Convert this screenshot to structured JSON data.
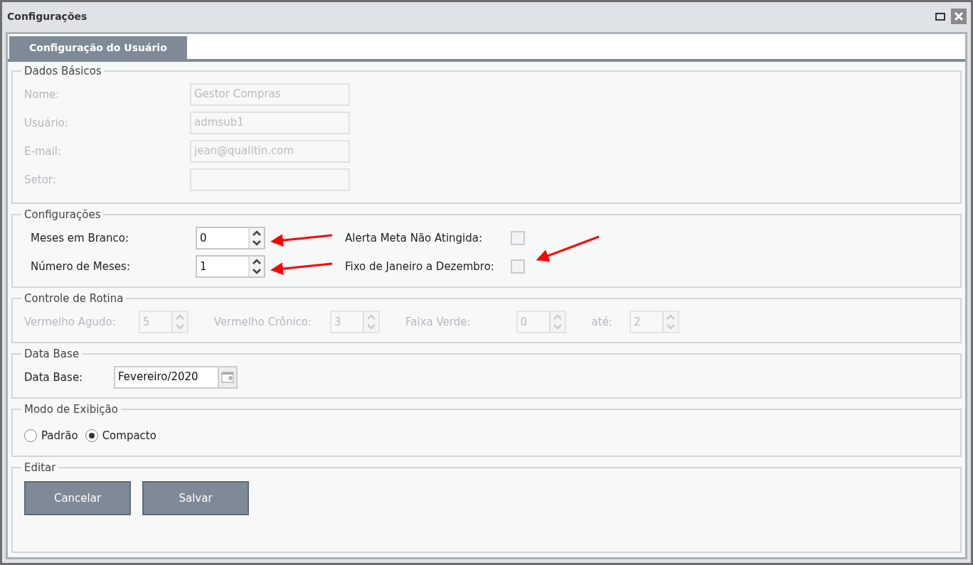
{
  "window": {
    "title": "Configurações"
  },
  "tabs": [
    {
      "label": "Configuração do Usuário",
      "selected": true
    }
  ],
  "dados_basicos": {
    "legend": "Dados Básicos",
    "fields": [
      {
        "label": "Nome:",
        "value": "Gestor Compras",
        "disabled": true
      },
      {
        "label": "Usuário:",
        "value": "admsub1",
        "disabled": true
      },
      {
        "label": "E-mail:",
        "value": "jean@qualitin.com",
        "disabled": true
      },
      {
        "label": "Setor:",
        "disabled": true
      }
    ]
  },
  "configuracoes": {
    "legend": "Configurações",
    "spinners": [
      {
        "label": "Meses em Branco:",
        "value": "0"
      },
      {
        "label": "Número de Meses:",
        "value": "1"
      }
    ],
    "checkboxes": [
      {
        "label": "Alerta Meta Não Atingida:",
        "checked": false
      },
      {
        "label": "Fixo de Janeiro a Dezembro:",
        "checked": false
      }
    ]
  },
  "controle_rotina": {
    "legend": "Controle de Rotina",
    "spinners": [
      {
        "label": "Vermelho Agudo:",
        "value": "5",
        "disabled": true
      },
      {
        "label": "Vermelho Crônico:",
        "value": "3",
        "disabled": true
      },
      {
        "label": "Faixa Verde:",
        "value": "0",
        "disabled": true
      },
      {
        "label": "até:",
        "value": "2",
        "disabled": true
      }
    ]
  },
  "data_base": {
    "legend": "Data Base",
    "label": "Data Base:",
    "value": "Fevereiro/2020"
  },
  "modo_exibicao": {
    "legend": "Modo de Exibição",
    "options": [
      {
        "label": "Padrão",
        "selected": false
      },
      {
        "label": "Compacto",
        "selected": true
      }
    ]
  },
  "editar": {
    "legend": "Editar",
    "buttons": [
      "Cancelar",
      "Salvar"
    ]
  }
}
